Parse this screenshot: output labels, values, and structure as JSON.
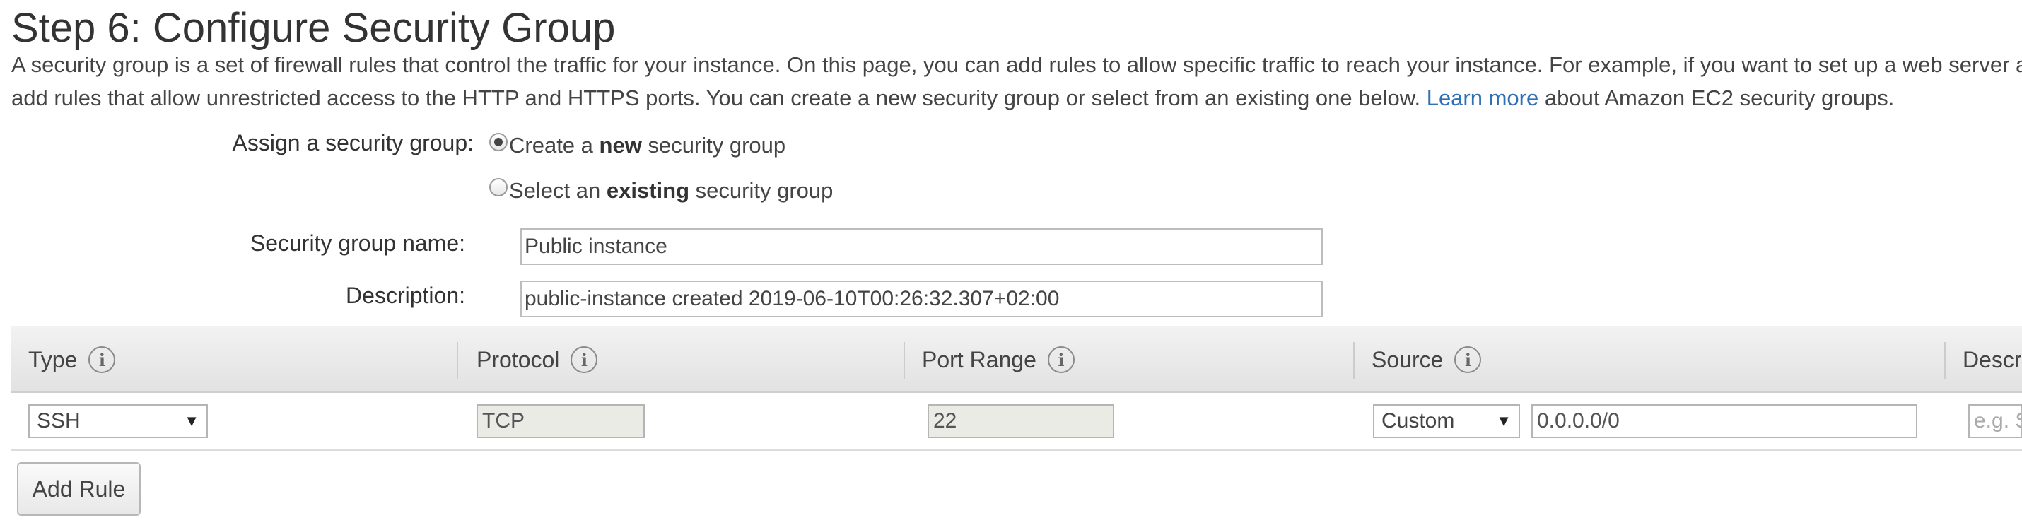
{
  "page": {
    "title": "Step 6: Configure Security Group",
    "intro_line1": "A security group is a set of firewall rules that control the traffic for your instance. On this page, you can add rules to allow specific traffic to reach your instance. For example, if you want to set up a web server a",
    "intro_line2_before": "add rules that allow unrestricted access to the HTTP and HTTPS ports. You can create a new security group or select from an existing one below.",
    "learn_more": "Learn more",
    "intro_line2_after": "about Amazon EC2 security groups."
  },
  "assign": {
    "label": "Assign a security group:",
    "option_new": {
      "prefix": "Create a",
      "emphasis": "new",
      "suffix": "security group",
      "selected": true
    },
    "option_existing": {
      "prefix": "Select an",
      "emphasis": "existing",
      "suffix": "security group",
      "selected": false
    }
  },
  "fields": {
    "name_label": "Security group name:",
    "name_value": "Public instance",
    "description_label": "Description:",
    "description_value": "public-instance created 2019-06-10T00:26:32.307+02:00"
  },
  "table": {
    "columns": [
      "Type",
      "Protocol",
      "Port Range",
      "Source",
      "Descr"
    ],
    "rows": [
      {
        "type": "SSH",
        "protocol": "TCP",
        "port_range": "22",
        "source_type": "Custom",
        "source_cidr": "0.0.0.0/0",
        "description_placeholder": "e.g. S"
      }
    ]
  },
  "actions": {
    "add_rule": "Add Rule"
  },
  "icons": {
    "info": "info-icon",
    "caret": "caret-down-icon"
  },
  "colors": {
    "link": "#2f6fb5",
    "header_bg": "#e8e8e8",
    "readonly_bg": "#ebebe6"
  }
}
